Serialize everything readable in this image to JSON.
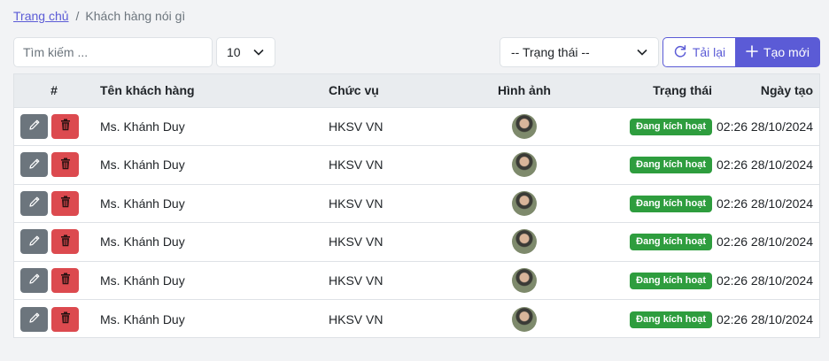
{
  "breadcrumb": {
    "home": "Trang chủ",
    "separator": "/",
    "current": "Khách hàng nói gì"
  },
  "toolbar": {
    "search_placeholder": "Tìm kiếm ...",
    "page_size": "10",
    "status_filter": "-- Trạng thái --",
    "reload_label": "Tải lại",
    "create_label": "Tạo mới"
  },
  "table": {
    "headers": {
      "index": "#",
      "name": "Tên khách hàng",
      "position": "Chức vụ",
      "image": "Hình ảnh",
      "status": "Trạng thái",
      "created": "Ngày tạo"
    },
    "rows": [
      {
        "name": "Ms. Khánh Duy",
        "position": "HKSV VN",
        "status": "Đang kích hoạt",
        "created": "02:26 28/10/2024"
      },
      {
        "name": "Ms. Khánh Duy",
        "position": "HKSV VN",
        "status": "Đang kích hoạt",
        "created": "02:26 28/10/2024"
      },
      {
        "name": "Ms. Khánh Duy",
        "position": "HKSV VN",
        "status": "Đang kích hoạt",
        "created": "02:26 28/10/2024"
      },
      {
        "name": "Ms. Khánh Duy",
        "position": "HKSV VN",
        "status": "Đang kích hoạt",
        "created": "02:26 28/10/2024"
      },
      {
        "name": "Ms. Khánh Duy",
        "position": "HKSV VN",
        "status": "Đang kích hoạt",
        "created": "02:26 28/10/2024"
      },
      {
        "name": "Ms. Khánh Duy",
        "position": "HKSV VN",
        "status": "Đang kích hoạt",
        "created": "02:26 28/10/2024"
      }
    ]
  },
  "icons": {
    "edit": "pencil-icon",
    "delete": "trash-icon",
    "reload": "refresh-icon",
    "create": "plus-icon",
    "dropdown": "chevron-down-icon"
  },
  "colors": {
    "accent": "#5b5bd6",
    "edit_button": "#6c757d",
    "delete_button": "#dc4a4f",
    "active_badge": "#2e9d3e",
    "page_background": "#f2f3f5"
  }
}
